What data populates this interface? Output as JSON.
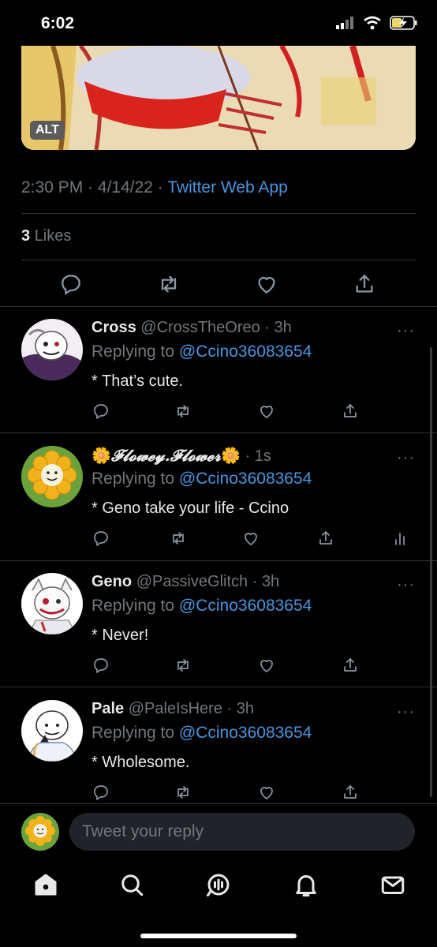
{
  "status_bar": {
    "time": "6:02"
  },
  "tweet": {
    "alt_badge": "ALT",
    "time": "2:30 PM",
    "date": "4/14/22",
    "source": "Twitter Web App",
    "likes_count": "3",
    "likes_label": "Likes"
  },
  "replies": [
    {
      "name": "Cross",
      "handle": "@CrossTheOreo",
      "time": "3h",
      "replying_prefix": "Replying to",
      "replying_to": "@Ccino36083654",
      "text": "* That’s cute."
    },
    {
      "name": "𝓕𝓵𝓸𝔀𝓮𝔂.𝓕𝓵𝓸𝔀𝓮𝓻",
      "handle": "",
      "time": "1s",
      "replying_prefix": "Replying to",
      "replying_to": "@Ccino36083654",
      "text": "* Geno take your life - Ccino"
    },
    {
      "name": "Geno",
      "handle": "@PassiveGlitch",
      "time": "3h",
      "replying_prefix": "Replying to",
      "replying_to": "@Ccino36083654",
      "text": "* Never!"
    },
    {
      "name": "Pale",
      "handle": "@PaleIsHere",
      "time": "3h",
      "replying_prefix": "Replying to",
      "replying_to": "@Ccino36083654",
      "text": "* Wholesome."
    }
  ],
  "compose": {
    "placeholder": "Tweet your reply"
  },
  "colors": {
    "background": "#000000",
    "link": "#4a95de",
    "muted": "#71767b"
  }
}
